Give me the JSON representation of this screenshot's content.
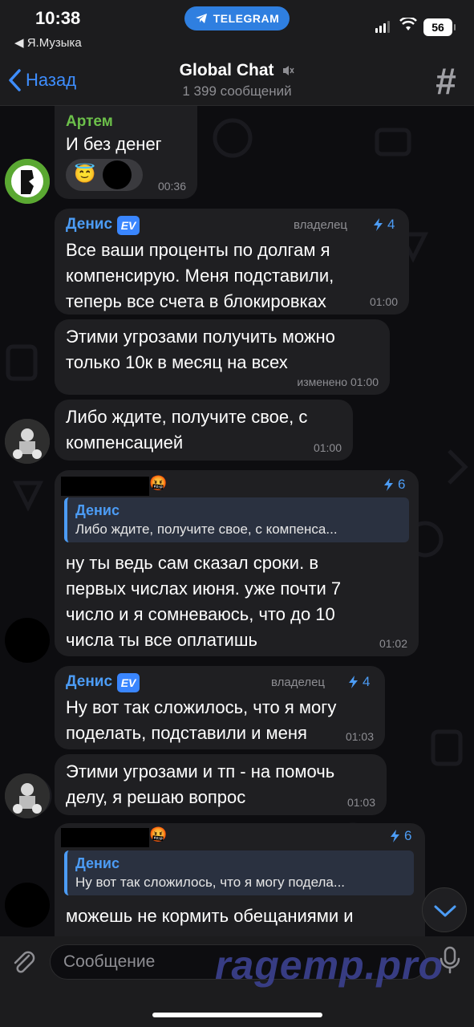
{
  "status_bar": {
    "time": "10:38",
    "back_app": "◀ Я.Музыка",
    "pill_label": "TELEGRAM",
    "battery": "56"
  },
  "header": {
    "back_label": "Назад",
    "title": "Global Chat",
    "subtitle": "1 399 сообщений",
    "hash": "#"
  },
  "messages": [
    {
      "sender": "Артем",
      "text": "И без денег",
      "time": "00:36",
      "reaction": "😇"
    },
    {
      "sender": "Денис",
      "badge": "EV",
      "role": "владелец",
      "boost": "4",
      "text": "Все ваши проценты по долгам я компенсирую. Меня подставили, теперь все счета в блокировках",
      "time": "01:00"
    },
    {
      "text": "Этими угрозами получить можно только 10к в месяц на всех",
      "time": "изменено 01:00"
    },
    {
      "text": "Либо ждите, получите свое, с компенсацией",
      "time": "01:00"
    },
    {
      "sender_emoji": "🤬",
      "boost": "6",
      "reply_name": "Денис",
      "reply_text": "Либо ждите, получите свое, с компенса...",
      "text": "ну ты ведь сам сказал сроки. в первых числах июня. уже почти 7 число и я сомневаюсь, что до 10 числа ты все оплатишь",
      "time": "01:02"
    },
    {
      "sender": "Денис",
      "badge": "EV",
      "role": "владелец",
      "boost": "4",
      "text": "Ну вот так сложилось, что я могу поделать, подставили и меня",
      "time": "01:03"
    },
    {
      "text": "Этими угрозами и тп - на помочь делу, я решаю вопрос",
      "time": "01:03"
    },
    {
      "sender_emoji": "🤬",
      "boost": "6",
      "reply_name": "Денис",
      "reply_text": "Ну вот так сложилось, что я могу подела...",
      "text": "можешь не кормить обещаниями и"
    }
  ],
  "input": {
    "placeholder": "Сообщение"
  },
  "watermark": "ragemp.pro",
  "colors": {
    "accent": "#3e8eff",
    "sender_green": "#6cc04a",
    "bubble": "#1f1f22"
  }
}
